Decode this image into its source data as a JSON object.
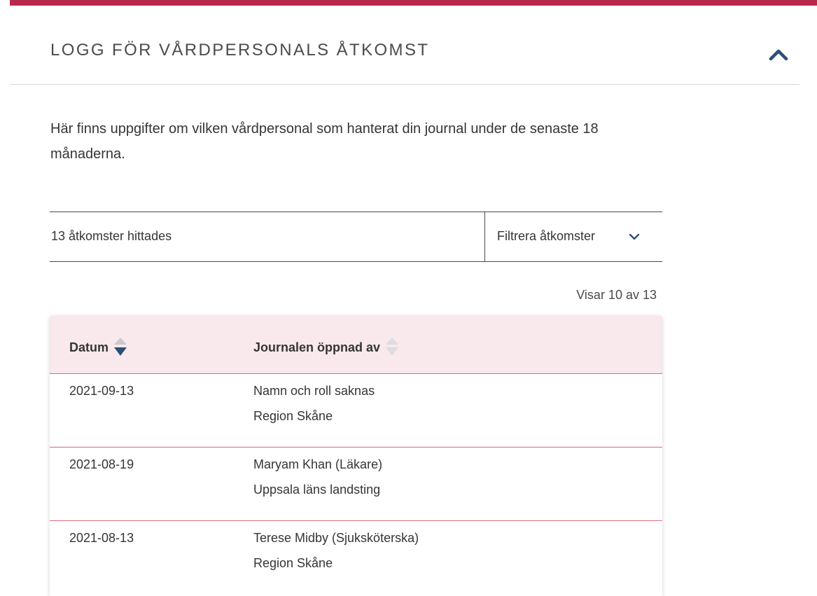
{
  "header": {
    "title": "LOGG FÖR VÅRDPERSONALS ÅTKOMST",
    "collapse_icon": "chevron-up-icon"
  },
  "intro": {
    "text": "Här finns uppgifter om vilken vårdpersonal som hanterat din journal under de senaste 18 månaderna."
  },
  "summary": {
    "count_text": "13 åtkomster hittades",
    "filter_label": "Filtrera åtkomster",
    "filter_icon": "chevron-down-icon"
  },
  "pagination": {
    "showing_text": "Visar 10 av 13"
  },
  "table": {
    "columns": [
      {
        "label": "Datum",
        "sort": "descending"
      },
      {
        "label": "Journalen öppnad av",
        "sort": "none"
      }
    ],
    "rows": [
      {
        "date": "2021-09-13",
        "name": "Namn och roll saknas",
        "org": "Region Skåne"
      },
      {
        "date": "2021-08-19",
        "name": "Maryam Khan (Läkare)",
        "org": "Uppsala läns landsting"
      },
      {
        "date": "2021-08-13",
        "name": "Terese Midby (Sjuksköterska)",
        "org": "Region Skåne"
      }
    ]
  },
  "colors": {
    "accent": "#b8284a",
    "header_bg": "#f9e9ec",
    "row_divider": "#d46a82",
    "icon_blue": "#2c4f75",
    "sort_inactive": "#c9c9d0"
  }
}
